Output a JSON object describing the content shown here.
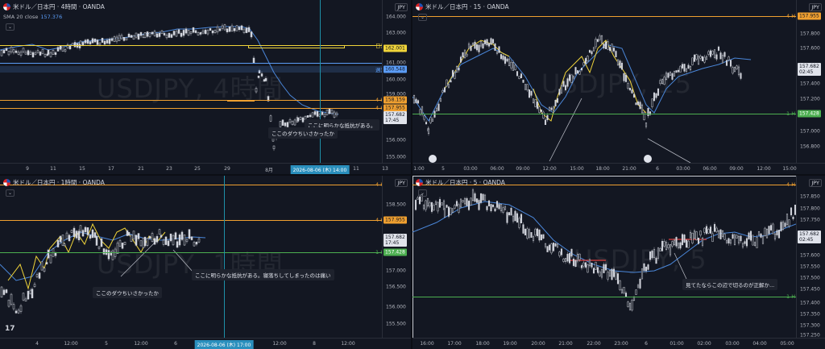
{
  "symbol": "米ドル／日本円",
  "broker": "OANDA",
  "currency": "JPY",
  "panes": [
    {
      "id": "p4h",
      "header": "米ドル／日本円 · 4時間 · OANDA",
      "sma_label": "SMA 20 close",
      "sma_value": "157.376",
      "watermark": "USDJPY, 4時間",
      "yticks": [
        "164.000",
        "163.000",
        "162.000",
        "161.000",
        "160.000",
        "159.000",
        "158.000",
        "157.000",
        "156.000",
        "155.000"
      ],
      "xticks": [
        "9",
        "11",
        "15",
        "17",
        "21",
        "23",
        "25",
        "29",
        "8月",
        "13"
      ],
      "x_selected": "2026-08-06 (木)  14:00",
      "x_after_sel": "11",
      "lines": [
        {
          "tag": "日足",
          "value": "162.001",
          "color": "#f0d43a"
        },
        {
          "tag": "週足",
          "value": "160.548",
          "color": "#5b9cf6"
        },
        {
          "tag": "4 H",
          "value": "158.159",
          "color": "#f0a030"
        },
        {
          "tag": "4 H",
          "value": "157.955",
          "color": "#f0a030"
        }
      ],
      "price": "157.682",
      "countdown": "17:45",
      "notes": [
        "ここに明らかな抵抗がある。",
        "ここのダウちいさかったか"
      ]
    },
    {
      "id": "p15",
      "header": "米ドル／日本円 · 15 · OANDA",
      "watermark": "USDJPY, 15",
      "yticks": [
        "158.000",
        "157.800",
        "157.600",
        "157.400",
        "157.200",
        "157.000",
        "156.800",
        "156.600"
      ],
      "xticks": [
        "1:00",
        "5",
        "03:00",
        "06:00",
        "09:00",
        "12:00",
        "15:00",
        "18:00",
        "21:00",
        "6",
        "03:00",
        "06:00",
        "09:00",
        "12:00",
        "15:00"
      ],
      "lines": [
        {
          "tag": "4 H",
          "value": "157.955",
          "color": "#f0a030"
        },
        {
          "tag": "1 H",
          "value": "157.428",
          "color": "#4caf50"
        }
      ],
      "price": "157.682",
      "countdown": "02:45"
    },
    {
      "id": "p1h",
      "header": "米ドル／日本円 · 1時間 · OANDA",
      "watermark": "USDJPY, 1時間",
      "yticks": [
        "158.500",
        "158.000",
        "157.500",
        "157.000",
        "156.500",
        "156.000",
        "155.500"
      ],
      "xticks": [
        "4",
        "12:00",
        "5",
        "12:00",
        "6",
        "12:00",
        "8",
        "12:00"
      ],
      "x_selected": "2026-08-06 (木)  17:00",
      "lines": [
        {
          "tag": "4 H",
          "value": "",
          "color": "#f0a030"
        },
        {
          "tag": "4 H",
          "value": "157.955",
          "color": "#f0a030"
        },
        {
          "tag": "1 H",
          "value": "157.428",
          "color": "#4caf50"
        }
      ],
      "price": "157.682",
      "countdown": "17:45",
      "notes": [
        "ここのダウちいさかったか",
        "ここに明らかな抵抗がある。寝落ちしてしまったのは痛い"
      ]
    },
    {
      "id": "p5",
      "header": "米ドル／日本円 · 5 · OANDA",
      "watermark": "USDJPY, 5",
      "yticks": [
        "157.850",
        "157.800",
        "157.750",
        "157.700",
        "157.650",
        "157.600",
        "157.550",
        "157.500",
        "157.450",
        "157.400",
        "157.350",
        "157.300",
        "157.250"
      ],
      "xticks": [
        "16:00",
        "17:00",
        "18:00",
        "19:00",
        "20:00",
        "21:00",
        "22:00",
        "23:00",
        "6",
        "01:00",
        "02:00",
        "03:00",
        "04:00",
        "05:00"
      ],
      "lines": [
        {
          "tag": "4 H",
          "value": "",
          "color": "#f0a030"
        },
        {
          "tag": "1 H",
          "value": "",
          "color": "#4caf50"
        }
      ],
      "price": "157.682",
      "countdown": "02:45",
      "notes": [
        "見てたならこの辺で切るのが正解か..."
      ]
    }
  ]
}
